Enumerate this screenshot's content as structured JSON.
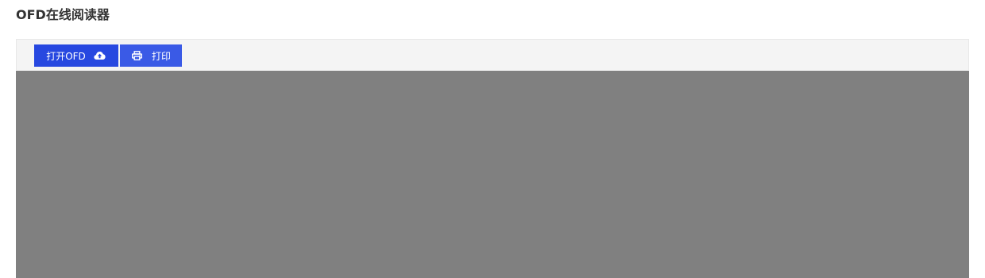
{
  "page": {
    "title": "OFD在线阅读器"
  },
  "toolbar": {
    "open_label": "打开OFD",
    "open_icon": "cloud-upload-icon",
    "print_label": "打印",
    "print_icon": "printer-icon",
    "open_color": "#2748e0",
    "print_color": "#3a5ae6"
  },
  "viewer": {
    "background_color": "#808080"
  }
}
